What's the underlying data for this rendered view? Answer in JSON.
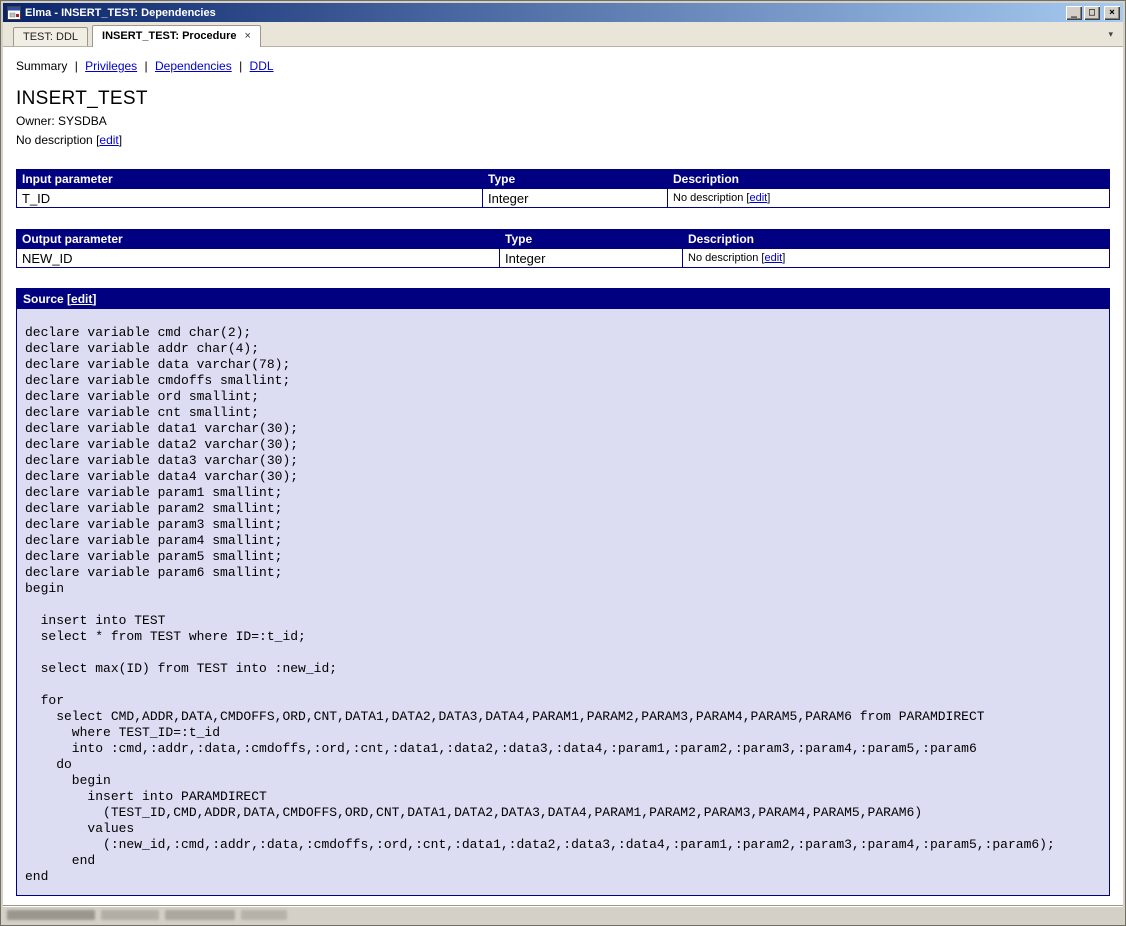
{
  "window": {
    "title": "Elma - INSERT_TEST: Dependencies",
    "controls": {
      "minimize": "_",
      "maximize": "□",
      "close": "×"
    }
  },
  "tab_bar": {
    "tabs": [
      {
        "label": "TEST: DDL"
      },
      {
        "label": "INSERT_TEST: Procedure",
        "close_glyph": "×"
      }
    ],
    "dropdown_glyph": "▾"
  },
  "nav": {
    "current": "Summary",
    "separator": "|",
    "links": [
      {
        "label": "Privileges"
      },
      {
        "label": "Dependencies"
      },
      {
        "label": "DDL"
      }
    ]
  },
  "object": {
    "name": "INSERT_TEST",
    "owner": "Owner: SYSDBA",
    "description": "No description"
  },
  "ui": {
    "edit": "edit",
    "lbracket": "[",
    "rbracket": "]"
  },
  "param_tables": [
    {
      "headers": [
        "Input parameter",
        "Type",
        "Description"
      ],
      "rows": [
        {
          "name": "T_ID",
          "type": "Integer",
          "description": "No description"
        }
      ]
    },
    {
      "headers": [
        "Output parameter",
        "Type",
        "Description"
      ],
      "rows": [
        {
          "name": "NEW_ID",
          "type": "Integer",
          "description": "No description"
        }
      ]
    }
  ],
  "source": {
    "title": "Source",
    "code": "declare variable cmd char(2);\ndeclare variable addr char(4);\ndeclare variable data varchar(78);\ndeclare variable cmdoffs smallint;\ndeclare variable ord smallint;\ndeclare variable cnt smallint;\ndeclare variable data1 varchar(30);\ndeclare variable data2 varchar(30);\ndeclare variable data3 varchar(30);\ndeclare variable data4 varchar(30);\ndeclare variable param1 smallint;\ndeclare variable param2 smallint;\ndeclare variable param3 smallint;\ndeclare variable param4 smallint;\ndeclare variable param5 smallint;\ndeclare variable param6 smallint;\nbegin\n\n  insert into TEST\n  select * from TEST where ID=:t_id;\n\n  select max(ID) from TEST into :new_id;\n\n  for\n    select CMD,ADDR,DATA,CMDOFFS,ORD,CNT,DATA1,DATA2,DATA3,DATA4,PARAM1,PARAM2,PARAM3,PARAM4,PARAM5,PARAM6 from PARAMDIRECT\n      where TEST_ID=:t_id\n      into :cmd,:addr,:data,:cmdoffs,:ord,:cnt,:data1,:data2,:data3,:data4,:param1,:param2,:param3,:param4,:param5,:param6\n    do\n      begin\n        insert into PARAMDIRECT\n          (TEST_ID,CMD,ADDR,DATA,CMDOFFS,ORD,CNT,DATA1,DATA2,DATA3,DATA4,PARAM1,PARAM2,PARAM3,PARAM4,PARAM5,PARAM6)\n        values\n          (:new_id,:cmd,:addr,:data,:cmdoffs,:ord,:cnt,:data1,:data2,:data3,:data4,:param1,:param2,:param3,:param4,:param5,:param6);\n      end\nend"
  },
  "colors": {
    "header_navy": "#000080",
    "source_bg": "#dcdcf2",
    "link_blue": "#0000cc",
    "titlebar_left": "#0a246a",
    "titlebar_right": "#a6caf0"
  }
}
